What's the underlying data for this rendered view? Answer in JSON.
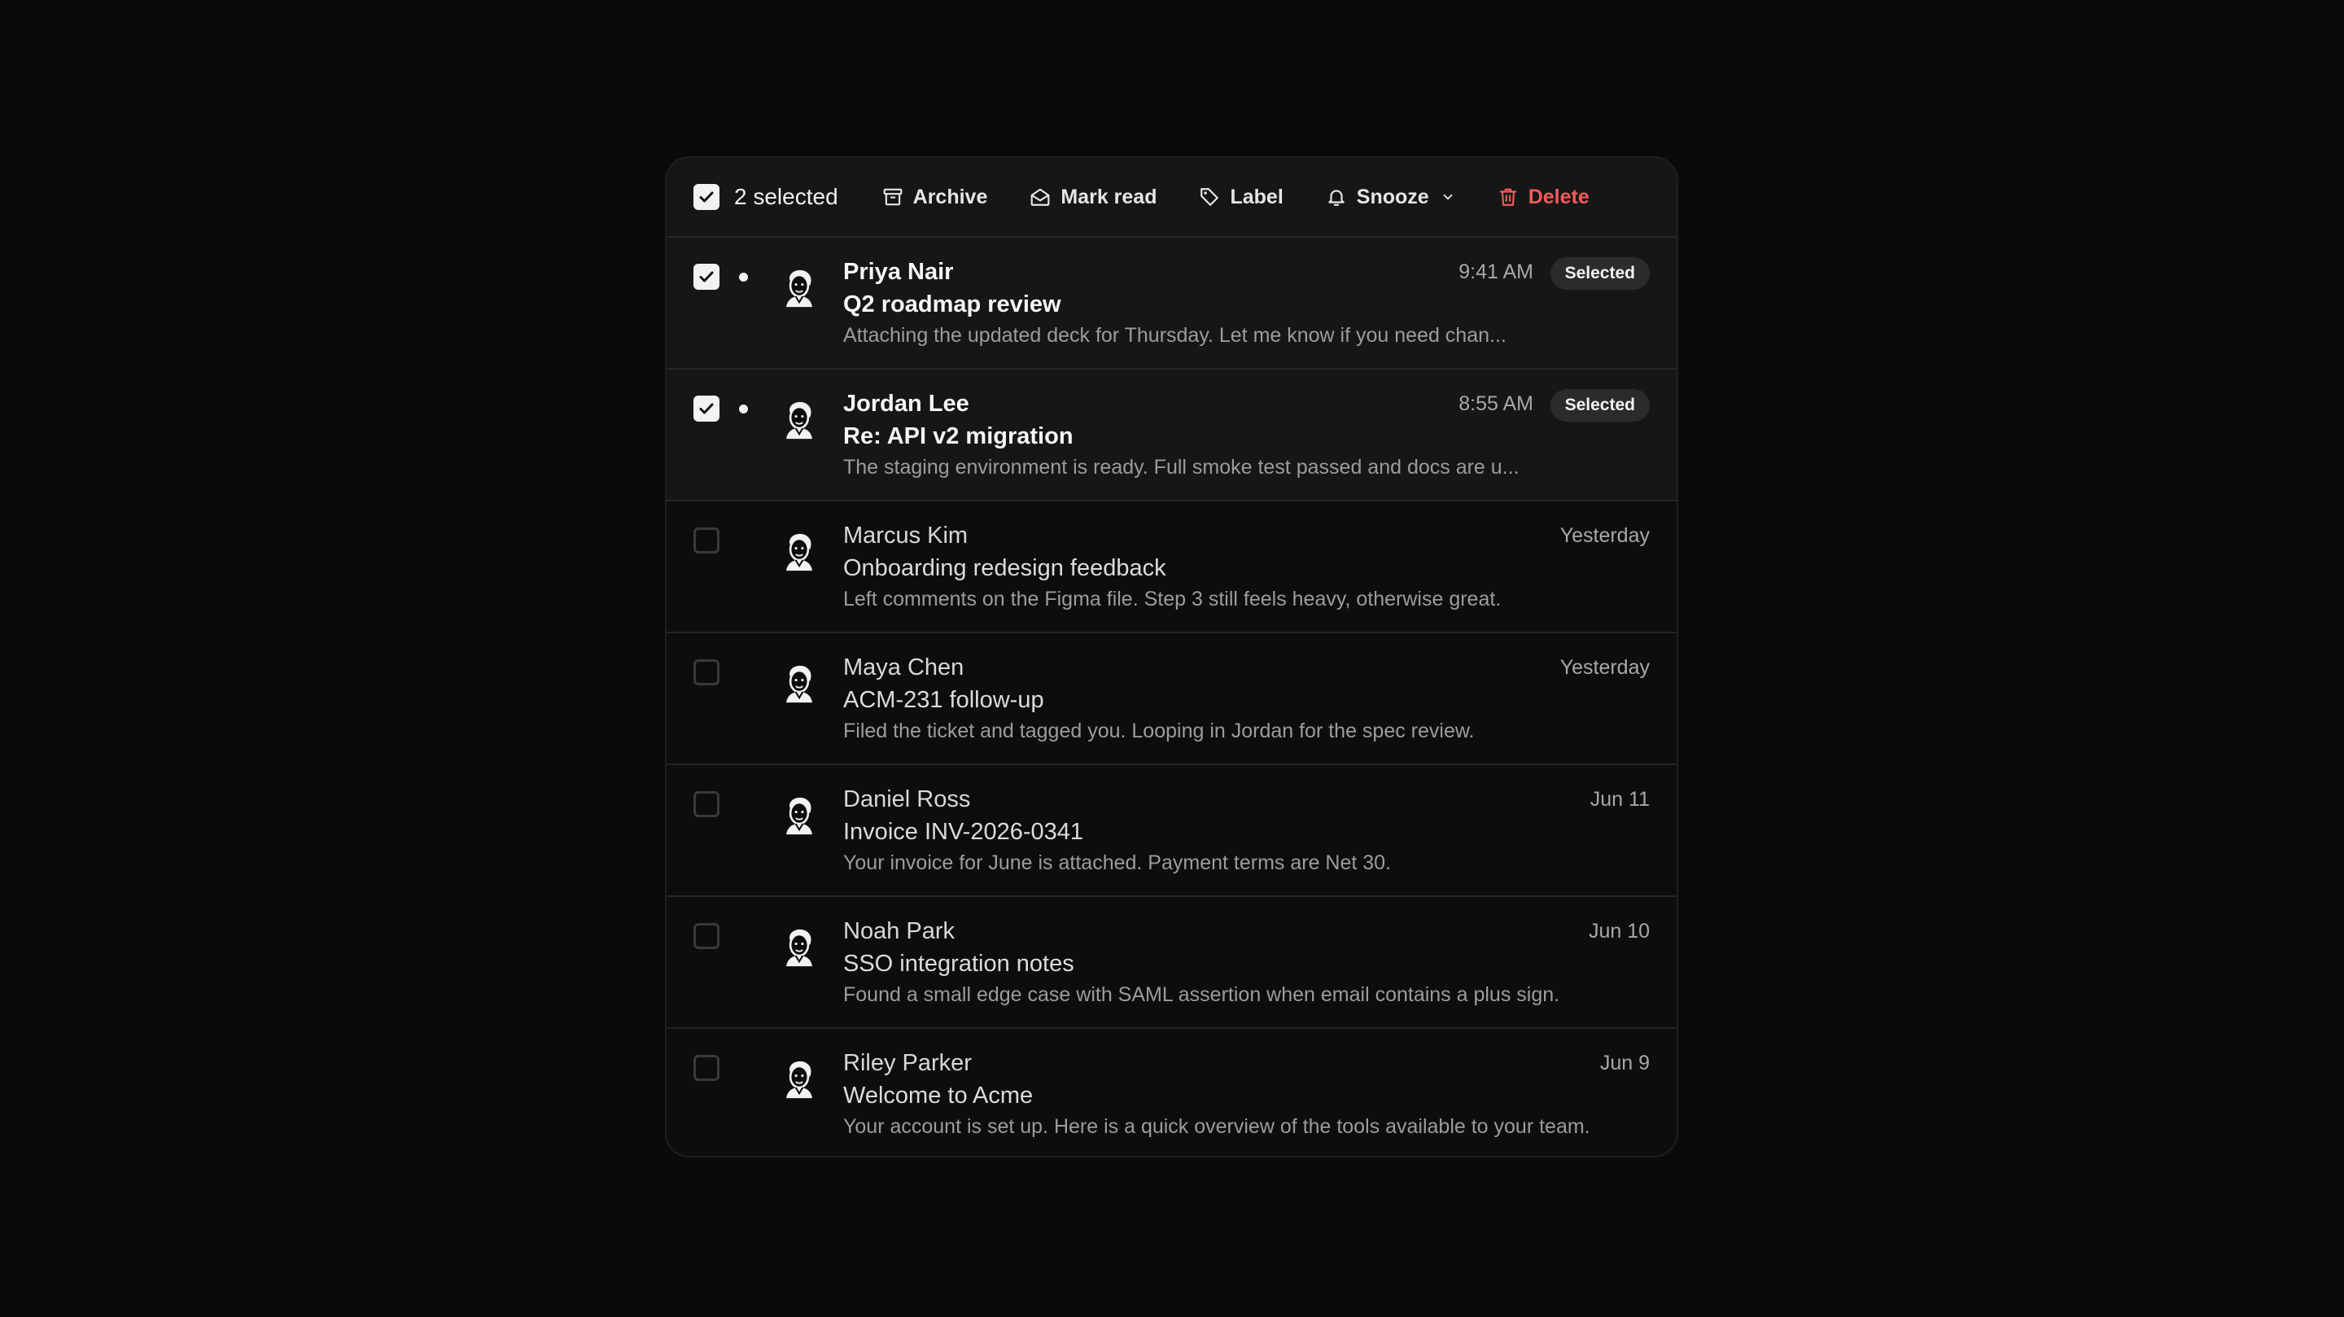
{
  "toolbar": {
    "selected_count": "2 selected",
    "actions": {
      "archive": "Archive",
      "mark_read": "Mark read",
      "label": "Label",
      "snooze": "Snooze",
      "delete": "Delete"
    },
    "delete_color": "#f05b5b"
  },
  "emails": [
    {
      "sender": "Priya Nair",
      "subject": "Q2 roadmap review",
      "preview": "Attaching the updated deck for Thursday. Let me know if you need chan...",
      "time": "9:41 AM",
      "selected": true,
      "unread": true,
      "badge": "Selected"
    },
    {
      "sender": "Jordan Lee",
      "subject": "Re: API v2 migration",
      "preview": "The staging environment is ready. Full smoke test passed and docs are u...",
      "time": "8:55 AM",
      "selected": true,
      "unread": true,
      "badge": "Selected"
    },
    {
      "sender": "Marcus Kim",
      "subject": "Onboarding redesign feedback",
      "preview": "Left comments on the Figma file. Step 3 still feels heavy, otherwise great.",
      "time": "Yesterday",
      "selected": false,
      "unread": false
    },
    {
      "sender": "Maya Chen",
      "subject": "ACM-231 follow-up",
      "preview": "Filed the ticket and tagged you. Looping in Jordan for the spec review.",
      "time": "Yesterday",
      "selected": false,
      "unread": false
    },
    {
      "sender": "Daniel Ross",
      "subject": "Invoice INV-2026-0341",
      "preview": "Your invoice for June is attached. Payment terms are Net 30.",
      "time": "Jun 11",
      "selected": false,
      "unread": false
    },
    {
      "sender": "Noah Park",
      "subject": "SSO integration notes",
      "preview": "Found a small edge case with SAML assertion when email contains a plus sign.",
      "time": "Jun 10",
      "selected": false,
      "unread": false
    },
    {
      "sender": "Riley Parker",
      "subject": "Welcome to Acme",
      "preview": "Your account is set up. Here is a quick overview of the tools available to your team.",
      "time": "Jun 9",
      "selected": false,
      "unread": false
    }
  ]
}
